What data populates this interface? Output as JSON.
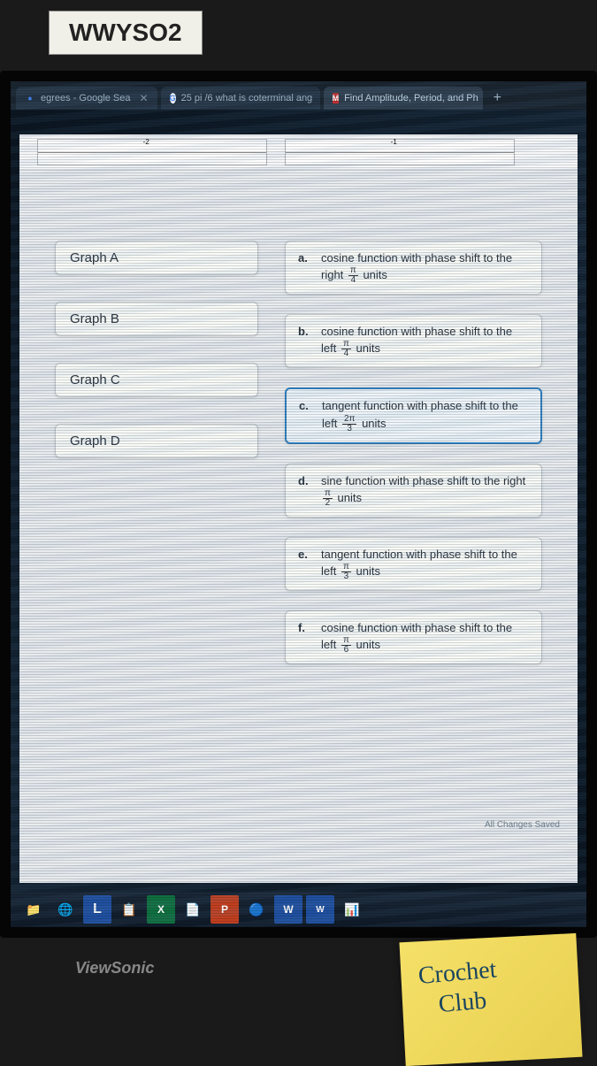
{
  "label": "WWYSO2",
  "tabs": [
    {
      "title": "egrees - Google Sea",
      "icon": "G"
    },
    {
      "title": "25 pi /6 what is coterminal ang",
      "icon": "G"
    },
    {
      "title": "Find Amplitude, Period, and Ph",
      "icon": "M",
      "active": true
    }
  ],
  "graphs": [
    {
      "label": "Graph A"
    },
    {
      "label": "Graph B"
    },
    {
      "label": "Graph C"
    },
    {
      "label": "Graph D"
    }
  ],
  "answers": [
    {
      "letter": "a.",
      "text": "cosine function with phase shift to the right",
      "frac_num": "π",
      "frac_den": "4",
      "suffix": "units",
      "selected": false
    },
    {
      "letter": "b.",
      "text": "cosine function with phase shift to the left",
      "frac_num": "π",
      "frac_den": "4",
      "suffix": "units",
      "selected": false
    },
    {
      "letter": "c.",
      "text": "tangent function with phase shift to the left",
      "frac_num": "2π",
      "frac_den": "3",
      "suffix": "units",
      "selected": true
    },
    {
      "letter": "d.",
      "text": "sine function with phase shift to the right",
      "frac_num": "π",
      "frac_den": "2",
      "suffix": "units",
      "selected": false
    },
    {
      "letter": "e.",
      "text": "tangent function with phase shift to the left",
      "frac_num": "π",
      "frac_den": "3",
      "suffix": "units",
      "selected": false
    },
    {
      "letter": "f.",
      "text": "cosine function with phase shift to the left",
      "frac_num": "π",
      "frac_den": "6",
      "suffix": "units",
      "selected": false
    }
  ],
  "saved_text": "All Changes Saved",
  "monitor_brand": "ViewSonic",
  "sticky_note": {
    "line1": "Crochet",
    "line2": "Club"
  }
}
